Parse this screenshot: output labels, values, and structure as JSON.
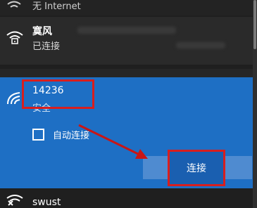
{
  "networks": {
    "top": {
      "label": "无 Internet"
    },
    "saved": {
      "name": "寞风",
      "status": "已连接"
    },
    "selected": {
      "name": "14236",
      "security": "安全",
      "auto_connect_label": "自动连接",
      "connect_label": "连接"
    },
    "bottom": {
      "name": "swust"
    }
  },
  "colors": {
    "selected_bg": "#1e6fc4",
    "connect_bg": "#1a5fb0",
    "annotation": "#d81e1e"
  }
}
